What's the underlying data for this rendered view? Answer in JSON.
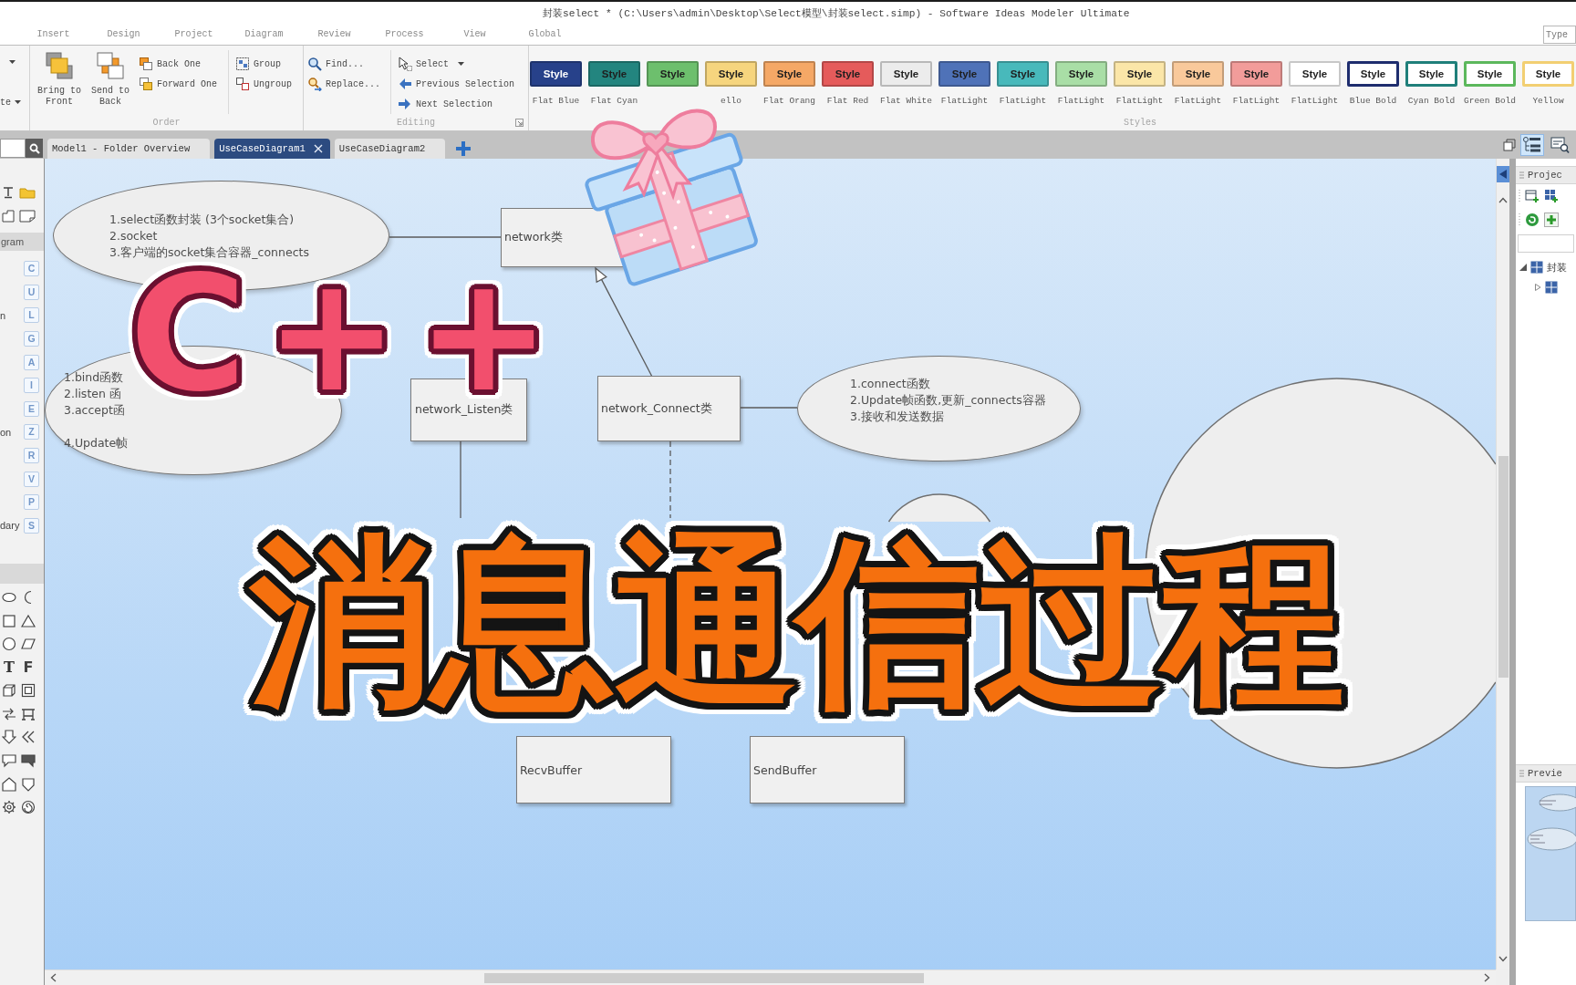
{
  "window": {
    "title": "封装select * (C:\\Users\\admin\\Desktop\\Select模型\\封装select.simp) - Software Ideas Modeler Ultimate"
  },
  "ribbon_tabs": [
    {
      "label": "Insert",
      "selected": false
    },
    {
      "label": "Design",
      "selected": false
    },
    {
      "label": "Project",
      "selected": false
    },
    {
      "label": "Diagram",
      "selected": false
    },
    {
      "label": "Review",
      "selected": false
    },
    {
      "label": "Process",
      "selected": false
    },
    {
      "label": "View",
      "selected": false
    },
    {
      "label": "Global",
      "selected": false
    }
  ],
  "search_box": {
    "placeholder": "Type"
  },
  "ribbon": {
    "clipped_group": {
      "label": "te"
    },
    "order_group": {
      "label": "Order",
      "large_buttons": [
        {
          "label": "Bring to Front"
        },
        {
          "label": "Send to Back"
        }
      ],
      "small_buttons": [
        {
          "label": "Back One"
        },
        {
          "label": "Forward One"
        }
      ],
      "grouping_buttons": [
        {
          "label": "Group"
        },
        {
          "label": "Ungroup"
        }
      ]
    },
    "editing_group": {
      "label": "Editing",
      "find_buttons": [
        {
          "label": "Find..."
        },
        {
          "label": "Replace..."
        }
      ],
      "selection_buttons": [
        {
          "label": "Select",
          "dropdown": true
        },
        {
          "label": "Previous Selection",
          "dropdown": false
        },
        {
          "label": "Next Selection",
          "dropdown": false
        }
      ]
    },
    "styles_group": {
      "label": "Styles",
      "swatches": [
        {
          "text": "Style",
          "caption": "Flat Blue",
          "kind": "flat",
          "color": "#27418a"
        },
        {
          "text": "Style",
          "caption": "Flat Cyan",
          "kind": "flat",
          "color": "#23857f"
        },
        {
          "text": "Style",
          "kind": "flat",
          "color": "#6dbf6d"
        },
        {
          "text": "Style",
          "caption": "ello",
          "kind": "flat",
          "color": "#f6d57e"
        },
        {
          "text": "Style",
          "caption": "Flat Orang",
          "kind": "flat",
          "color": "#f5a866"
        },
        {
          "text": "Style",
          "caption": "Flat Red",
          "kind": "flat",
          "color": "#e55b5b"
        },
        {
          "text": "Style",
          "caption": "Flat White",
          "kind": "flat",
          "color": "#ececec"
        },
        {
          "text": "Style",
          "caption": "FlatLight",
          "kind": "flat",
          "color": "#4f72b8"
        },
        {
          "text": "Style",
          "caption": "FlatLight",
          "kind": "flat",
          "color": "#48b9bb"
        },
        {
          "text": "Style",
          "caption": "FlatLight",
          "kind": "flat",
          "color": "#a9dea6"
        },
        {
          "text": "Style",
          "caption": "FlatLight",
          "kind": "flat",
          "color": "#fbe6a8"
        },
        {
          "text": "Style",
          "caption": "FlatLight",
          "kind": "flat",
          "color": "#f9c99b"
        },
        {
          "text": "Style",
          "caption": "FlatLight",
          "kind": "flat",
          "color": "#f29c9a"
        },
        {
          "text": "Style",
          "caption": "FlatLight",
          "kind": "flat",
          "color": "#ffffff"
        },
        {
          "text": "Style",
          "caption": "Blue Bold",
          "kind": "bold",
          "color": "#1e2d6e"
        },
        {
          "text": "Style",
          "caption": "Cyan Bold",
          "kind": "bold",
          "color": "#1f7f7a"
        },
        {
          "text": "Style",
          "caption": "Green Bold",
          "kind": "bold",
          "color": "#5cb85c"
        },
        {
          "text": "Style",
          "caption": "Yellow",
          "kind": "bold",
          "color": "#f2cf72"
        }
      ]
    }
  },
  "document_tabs": [
    {
      "label": "Model1 - Folder Overview",
      "selected": false
    },
    {
      "label": "UseCaseDiagram1",
      "selected": true
    },
    {
      "label": "UseCaseDiagram2",
      "selected": false
    }
  ],
  "panel_toggles": [
    {
      "selected": true
    },
    {
      "selected": false
    }
  ],
  "toolbox": {
    "section_title": "gram",
    "letter_tools": [
      {
        "letter": "C"
      },
      {
        "letter": "U"
      },
      {
        "letter": "L",
        "label": "n"
      },
      {
        "letter": "G"
      },
      {
        "letter": "A"
      },
      {
        "letter": "I"
      },
      {
        "letter": "E"
      },
      {
        "letter": "Z",
        "label": "on"
      },
      {
        "letter": "R"
      },
      {
        "letter": "V"
      },
      {
        "letter": "P"
      },
      {
        "letter": "S",
        "label": "dary"
      }
    ],
    "glyph_tools": [
      "T",
      "F"
    ]
  },
  "diagram": {
    "shapes": [
      {
        "kind": "note",
        "paragraphs": [
          [
            "1.select函数封装 (3个socket集合)",
            "2.socket",
            "3.客户端的socket集合容器_connects"
          ]
        ]
      },
      {
        "kind": "class",
        "label": "network类"
      },
      {
        "kind": "note",
        "paragraphs": [
          [
            "1.bind函数",
            "2.listen 函",
            "3.accept函"
          ],
          [
            "4.Update帧"
          ]
        ]
      },
      {
        "kind": "class",
        "label": "network_Listen类"
      },
      {
        "kind": "class",
        "label": "network_Connect类"
      },
      {
        "kind": "note",
        "paragraphs": [
          [
            "1.connect函数",
            "2.Update帧函数,更新_connects容器",
            "3.接收和发送数据"
          ]
        ]
      },
      {
        "kind": "ellipse"
      },
      {
        "kind": "ellipse"
      },
      {
        "kind": "class",
        "label": "RecvBuffer"
      },
      {
        "kind": "class",
        "label": "SendBuffer"
      }
    ]
  },
  "overlay": {
    "badge": "C++",
    "headline": "消息通信过程"
  },
  "project_panel": {
    "title": "Projec",
    "tree": [
      {
        "label": "封装",
        "expanded": true,
        "children": [
          {
            "expanded": false
          }
        ]
      }
    ]
  },
  "preview_panel": {
    "title": "Previe"
  }
}
